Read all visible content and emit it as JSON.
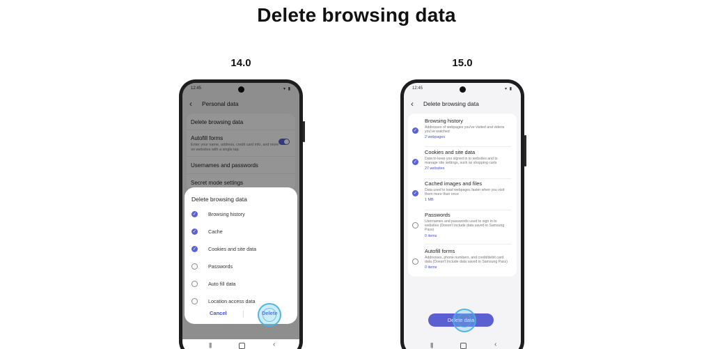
{
  "page_title": "Delete browsing data",
  "versions": {
    "left": "14.0",
    "right": "15.0"
  },
  "colors": {
    "accent": "#5b62d6",
    "primary_button": "#5b5fcf",
    "link_text": "#4a51c8",
    "tap_indicator": "#46afe1"
  },
  "phone_v14": {
    "status_time": "12:45",
    "app_bar_title": "Personal data",
    "settings": {
      "delete_browsing_data": "Delete browsing data",
      "autofill_forms": "Autofill forms",
      "autofill_forms_desc": "Enter your name, address, credit card info, and more on websites with a single tap.",
      "usernames_passwords": "Usernames and passwords",
      "secret_mode": "Secret mode settings"
    },
    "dialog": {
      "title": "Delete browsing data",
      "options": [
        {
          "label": "Browsing history",
          "checked": true
        },
        {
          "label": "Cache",
          "checked": true
        },
        {
          "label": "Cookies and site data",
          "checked": true
        },
        {
          "label": "Passwords",
          "checked": false
        },
        {
          "label": "Auto fill data",
          "checked": false
        },
        {
          "label": "Location access data",
          "checked": false
        }
      ],
      "cancel": "Cancel",
      "delete": "Delete"
    }
  },
  "phone_v15": {
    "status_time": "12:45",
    "app_bar_title": "Delete browsing data",
    "items": [
      {
        "title": "Browsing history",
        "desc": "Addresses of webpages you've visited and videos you've watched",
        "count": "2 webpages",
        "checked": true
      },
      {
        "title": "Cookies and site data",
        "desc": "Data to keep you signed in to websites and to manage site settings, such as shopping carts",
        "count": "27 websites",
        "checked": true
      },
      {
        "title": "Cached images and files",
        "desc": "Data used to load webpages faster when you visit them more than once",
        "count": "1 MB",
        "checked": true
      },
      {
        "title": "Passwords",
        "desc": "Usernames and passwords used to sign in to websites (Doesn't include data saved in Samsung Pass)",
        "count": "0 items",
        "checked": false
      },
      {
        "title": "Autofill forms",
        "desc": "Addresses, phone numbers, and credit/debit card data (Doesn't include data saved in Samsung Pass)",
        "count": "0 items",
        "checked": false
      }
    ],
    "delete_button": "Delete data"
  }
}
